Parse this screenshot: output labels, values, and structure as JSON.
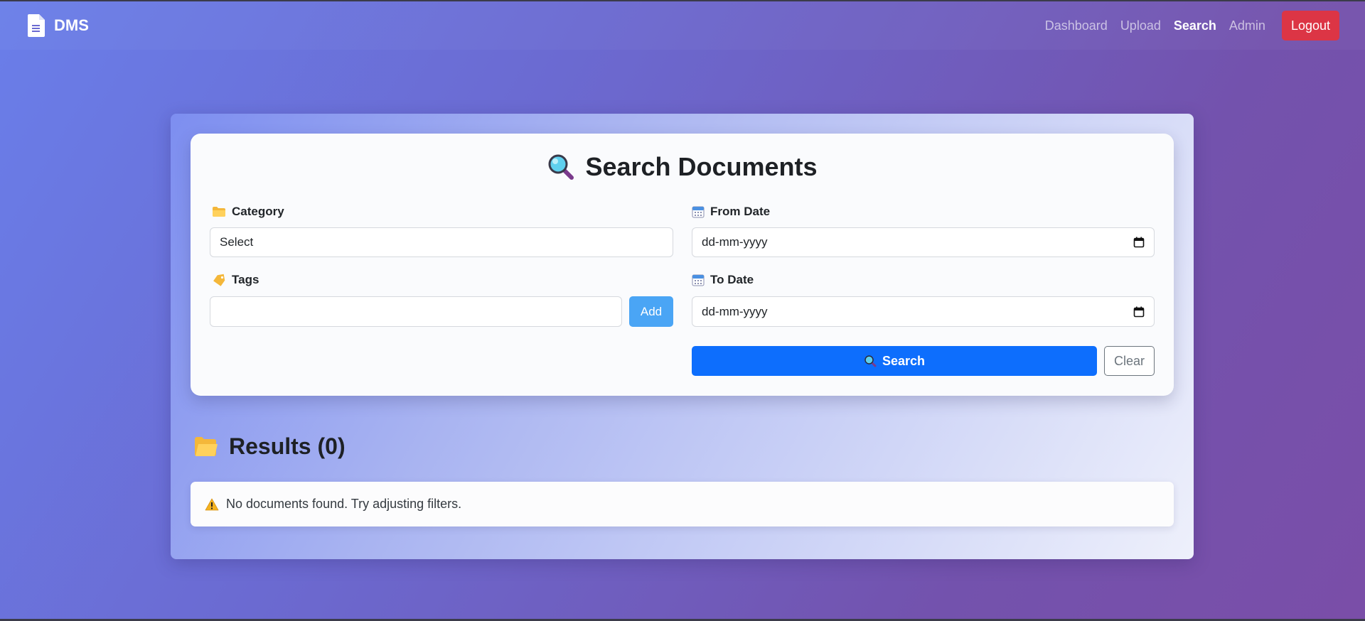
{
  "navbar": {
    "brand": "DMS",
    "links": [
      "Dashboard",
      "Upload",
      "Search",
      "Admin"
    ],
    "active_link": "Search",
    "logout_label": "Logout"
  },
  "search_form": {
    "title": "Search Documents",
    "category": {
      "label": "Category",
      "value": "Select"
    },
    "from_date": {
      "label": "From Date",
      "placeholder": "dd-mm-yyyy"
    },
    "tags": {
      "label": "Tags",
      "value": "",
      "add_label": "Add"
    },
    "to_date": {
      "label": "To Date",
      "placeholder": "dd-mm-yyyy"
    },
    "search_label": "Search",
    "clear_label": "Clear"
  },
  "results": {
    "heading": "Results (0)",
    "empty_message": "No documents found. Try adjusting filters."
  },
  "colors": {
    "primary": "#0d6efd",
    "danger": "#dc3545",
    "add_button": "#4aa5f5"
  }
}
